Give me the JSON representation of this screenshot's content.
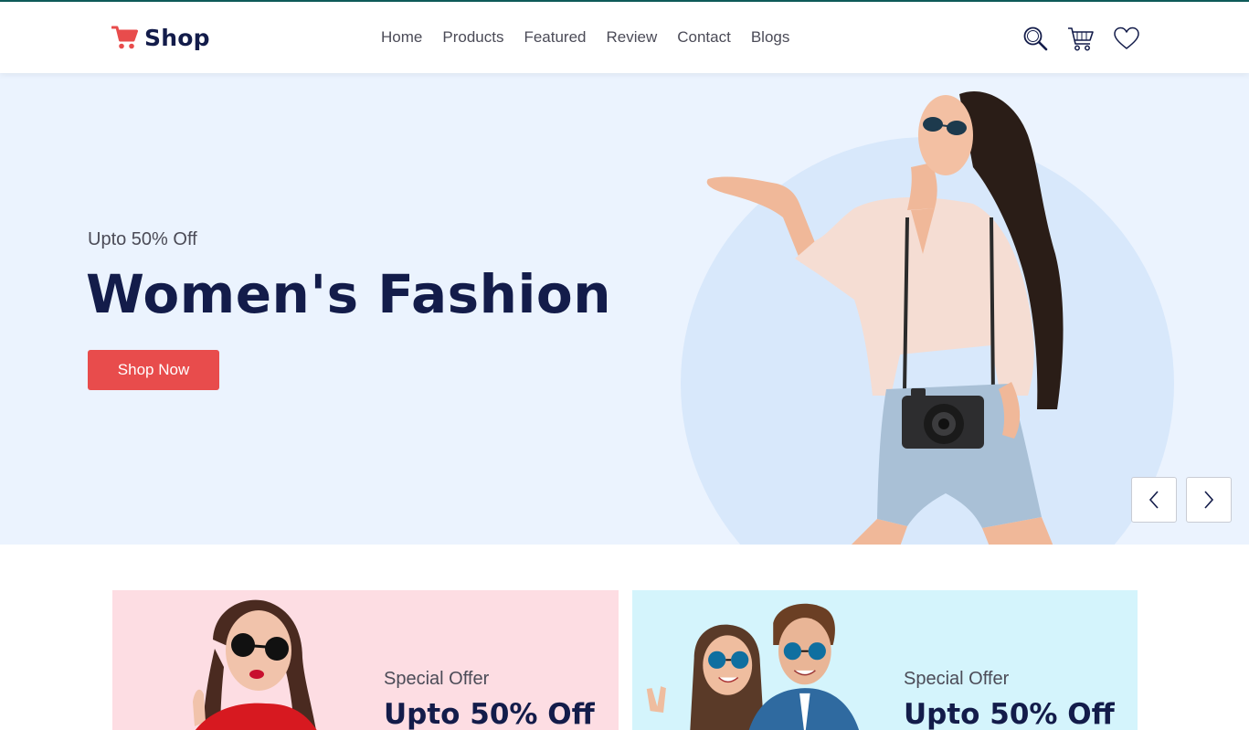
{
  "brand": {
    "name": "Shop",
    "icon": "cart-icon",
    "accent": "#e84c4c"
  },
  "nav": {
    "items": [
      {
        "label": "Home"
      },
      {
        "label": "Products"
      },
      {
        "label": "Featured"
      },
      {
        "label": "Review"
      },
      {
        "label": "Contact"
      },
      {
        "label": "Blogs"
      }
    ]
  },
  "toolbar": {
    "icons": [
      "search-icon",
      "cart-icon",
      "heart-icon"
    ]
  },
  "hero": {
    "subtitle": "Upto 50% Off",
    "title": "Women's Fashion",
    "button_label": "Shop Now",
    "controls": [
      "chevron-left-icon",
      "chevron-right-icon"
    ]
  },
  "offers": [
    {
      "subtitle": "Special Offer",
      "title": "Upto 50% Off",
      "background": "#fddde3"
    },
    {
      "subtitle": "Special Offer",
      "title": "Upto 50% Off",
      "background": "#d4f4fc"
    }
  ],
  "colors": {
    "heading": "#131c4a",
    "button": "#e84c4c",
    "hero_bg": "#ebf3fe",
    "hero_circle": "#d8e8fb"
  }
}
